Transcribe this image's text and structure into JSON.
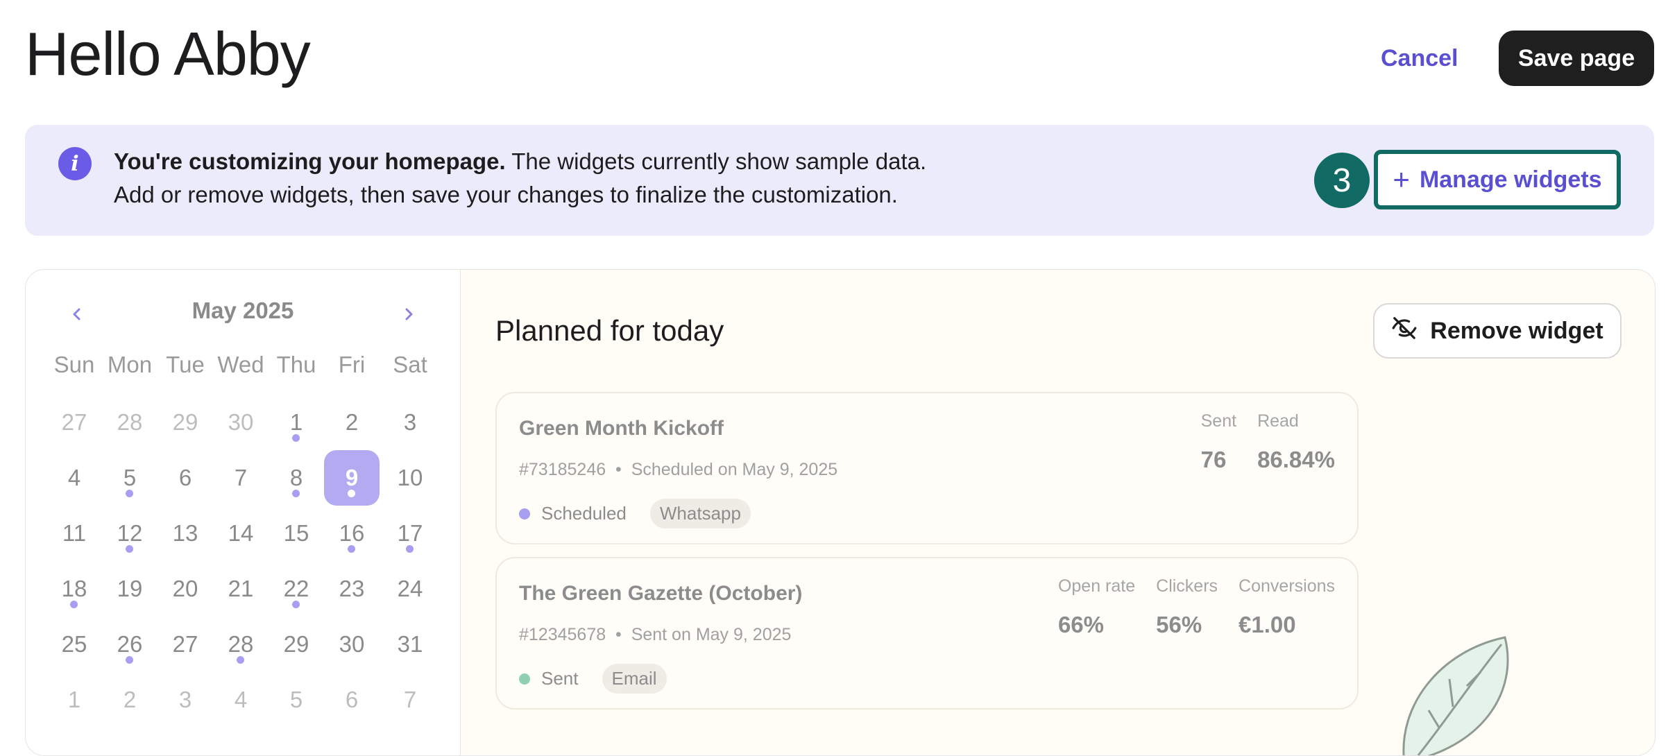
{
  "header": {
    "title": "Hello Abby",
    "cancel_label": "Cancel",
    "save_label": "Save page"
  },
  "banner": {
    "bold_text": "You're customizing your homepage.",
    "text": " The widgets currently show sample data.",
    "line2": "Add or remove widgets, then save your changes to finalize the customization.",
    "step_number": "3",
    "manage_label": "Manage widgets"
  },
  "calendar": {
    "month": "May 2025",
    "weekdays": [
      "Sun",
      "Mon",
      "Tue",
      "Wed",
      "Thu",
      "Fri",
      "Sat"
    ],
    "weeks": [
      [
        {
          "d": "27",
          "muted": true
        },
        {
          "d": "28",
          "muted": true
        },
        {
          "d": "29",
          "muted": true
        },
        {
          "d": "30",
          "muted": true
        },
        {
          "d": "1",
          "dot": true
        },
        {
          "d": "2"
        },
        {
          "d": "3"
        }
      ],
      [
        {
          "d": "4"
        },
        {
          "d": "5",
          "dot": true
        },
        {
          "d": "6"
        },
        {
          "d": "7"
        },
        {
          "d": "8",
          "dot": true
        },
        {
          "d": "9",
          "dot": true,
          "selected": true
        },
        {
          "d": "10"
        }
      ],
      [
        {
          "d": "11"
        },
        {
          "d": "12",
          "dot": true
        },
        {
          "d": "13"
        },
        {
          "d": "14"
        },
        {
          "d": "15"
        },
        {
          "d": "16",
          "dot": true
        },
        {
          "d": "17",
          "dot": true
        }
      ],
      [
        {
          "d": "18",
          "dot": true
        },
        {
          "d": "19"
        },
        {
          "d": "20"
        },
        {
          "d": "21"
        },
        {
          "d": "22",
          "dot": true
        },
        {
          "d": "23"
        },
        {
          "d": "24"
        }
      ],
      [
        {
          "d": "25"
        },
        {
          "d": "26",
          "dot": true
        },
        {
          "d": "27"
        },
        {
          "d": "28",
          "dot": true
        },
        {
          "d": "29"
        },
        {
          "d": "30"
        },
        {
          "d": "31"
        }
      ],
      [
        {
          "d": "1",
          "muted": true
        },
        {
          "d": "2",
          "muted": true
        },
        {
          "d": "3",
          "muted": true
        },
        {
          "d": "4",
          "muted": true
        },
        {
          "d": "5",
          "muted": true
        },
        {
          "d": "6",
          "muted": true
        },
        {
          "d": "7",
          "muted": true
        }
      ]
    ]
  },
  "planned": {
    "title": "Planned for today",
    "remove_label": "Remove widget",
    "campaigns": [
      {
        "title": "Green Month Kickoff",
        "id": "#73185246",
        "schedule": "Scheduled on May 9, 2025",
        "status": "Scheduled",
        "status_color": "#a89ef0",
        "channel": "Whatsapp",
        "metrics": [
          {
            "label": "Sent",
            "value": "76"
          },
          {
            "label": "Read",
            "value": "86.84%"
          }
        ]
      },
      {
        "title": "The Green Gazette (October)",
        "id": "#12345678",
        "schedule": "Sent on May 9, 2025",
        "status": "Sent",
        "status_color": "#8fd0b0",
        "channel": "Email",
        "metrics": [
          {
            "label": "Open rate",
            "value": "66%"
          },
          {
            "label": "Clickers",
            "value": "56%"
          },
          {
            "label": "Conversions",
            "value": "€1.00"
          }
        ]
      }
    ]
  },
  "colors": {
    "accent": "#5b4fd1",
    "badge": "#116a64",
    "banner_bg": "#ecebfb",
    "selected_day": "#b3abf1"
  }
}
